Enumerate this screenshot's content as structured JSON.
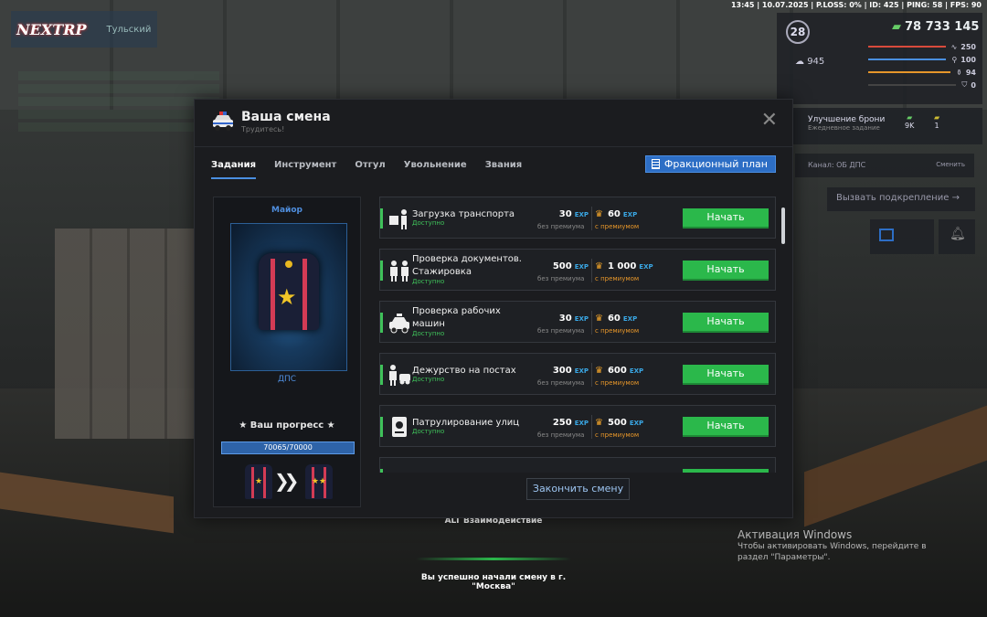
{
  "hud": {
    "topbar": "13:45 | 10.07.2025 | P.LOSS: 0% | ID: 425 | PING: 58 | FPS: 90",
    "logo": "NEXTRP",
    "server": "Тульский",
    "level": "28",
    "money": "78 733 145",
    "karma": "945",
    "stats": [
      "250",
      "100",
      "94",
      "0"
    ],
    "stat100": "100",
    "quest_title": "Улучшение брони",
    "quest_sub": "Ежедневное задание",
    "quest_r1": "9K",
    "quest_r2": "1",
    "channel": "Канал: ОБ ДПС",
    "channel_switch": "Сменить",
    "backup": "Вызвать подкрепление",
    "interact": "ALT Взаимодействие",
    "notice": "Вы успешно начали смену в г. \"Москва\"",
    "win_title": "Активация Windows",
    "win_sub": "Чтобы активировать Windows, перейдите в раздел \"Параметры\".",
    "colors": {
      "accent": "#2d6ec5",
      "start": "#2bb84b",
      "exp": "#3aa8e6",
      "premium": "#e6962a"
    }
  },
  "modal": {
    "title": "Ваша смена",
    "subtitle": "Трудитесь!",
    "close_icon": "close-icon",
    "tabs": [
      "Задания",
      "Инструмент",
      "Отгул",
      "Увольнение",
      "Звания"
    ],
    "plan_button": "Фракционный план",
    "rank": {
      "name": "Майор",
      "department": "ДПС",
      "progress_label": "★ Ваш прогресс ★",
      "progress_text": "70065/70000",
      "progress_fraction": 1.0
    },
    "tasks": [
      {
        "name": "Загрузка транспорта",
        "status": "Доступно",
        "base": "30",
        "premium": "60",
        "icon": "loader-icon"
      },
      {
        "name": "Проверка документов. Стажировка",
        "status": "Доступно",
        "base": "500",
        "premium": "1 000",
        "icon": "officers-icon"
      },
      {
        "name": "Проверка рабочих машин",
        "status": "Доступно",
        "base": "30",
        "premium": "60",
        "icon": "police-car-icon"
      },
      {
        "name": "Дежурство на постах",
        "status": "Доступно",
        "base": "300",
        "premium": "600",
        "icon": "guard-post-icon"
      },
      {
        "name": "Патрулирование улиц",
        "status": "Доступно",
        "base": "250",
        "premium": "500",
        "icon": "passport-icon"
      }
    ],
    "exp_tag": "EXP",
    "base_label": "без премиума",
    "premium_label": "с премиумом",
    "start_label": "Начать",
    "finish_button": "Закончить смену"
  }
}
